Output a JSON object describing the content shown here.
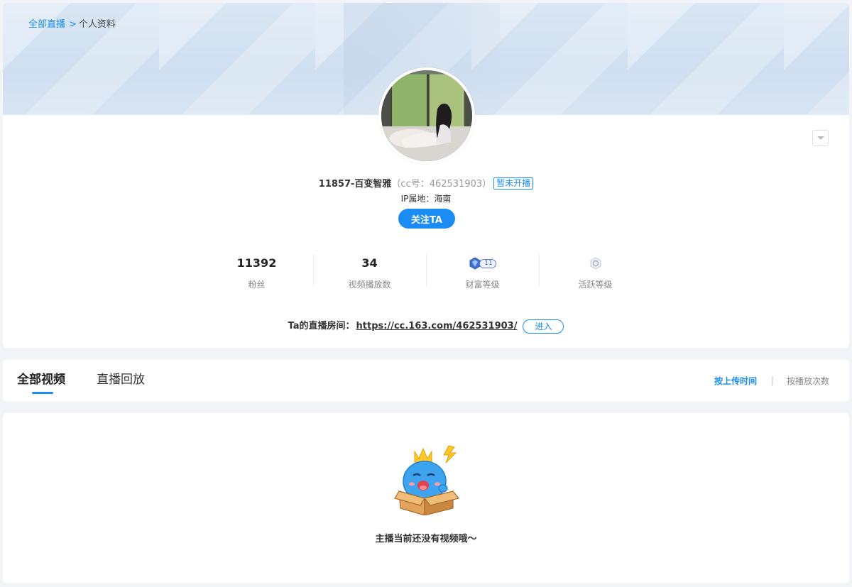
{
  "breadcrumb": {
    "home": "全部直播",
    "separator": ">",
    "current": "个人资料"
  },
  "profile": {
    "name": "11857-百变智雅",
    "cc_prefix": "（cc号：",
    "cc_number": "462531903",
    "cc_suffix": "）",
    "status_badge": "暂未开播",
    "ip_location": "IP属地：海南",
    "follow_label": "关注TA"
  },
  "stats": [
    {
      "value": "11392",
      "label": "粉丝"
    },
    {
      "value": "34",
      "label": "视频播放数"
    },
    {
      "label": "财富等级",
      "icon": "wealth-level-badge",
      "level": "11"
    },
    {
      "label": "活跃等级",
      "icon": "activity-level-badge"
    }
  ],
  "room": {
    "label": "Ta的直播房间：",
    "url": "https://cc.163.com/462531903/",
    "enter_label": "进入"
  },
  "tabs": [
    {
      "label": "全部视频",
      "active": true
    },
    {
      "label": "直播回放",
      "active": false
    }
  ],
  "sort": {
    "by_upload": "按上传时间",
    "separator": "|",
    "by_plays": "按播放次数"
  },
  "empty": {
    "text": "主播当前还没有视频哦～"
  },
  "colors": {
    "accent": "#1a8cf3",
    "background": "#f2f4f7"
  }
}
